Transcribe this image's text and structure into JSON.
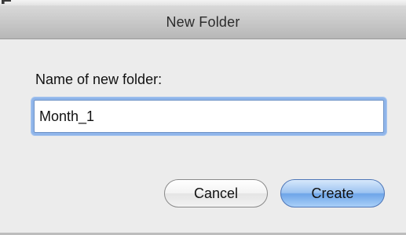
{
  "dialog": {
    "title": "New Folder",
    "prompt_label": "Name of new folder:",
    "folder_name_value": "Month_1",
    "cancel_label": "Cancel",
    "create_label": "Create"
  },
  "colors": {
    "focus_ring": "#8fb5ea",
    "default_button": "#6ea5e8",
    "window_background": "#ececec"
  }
}
